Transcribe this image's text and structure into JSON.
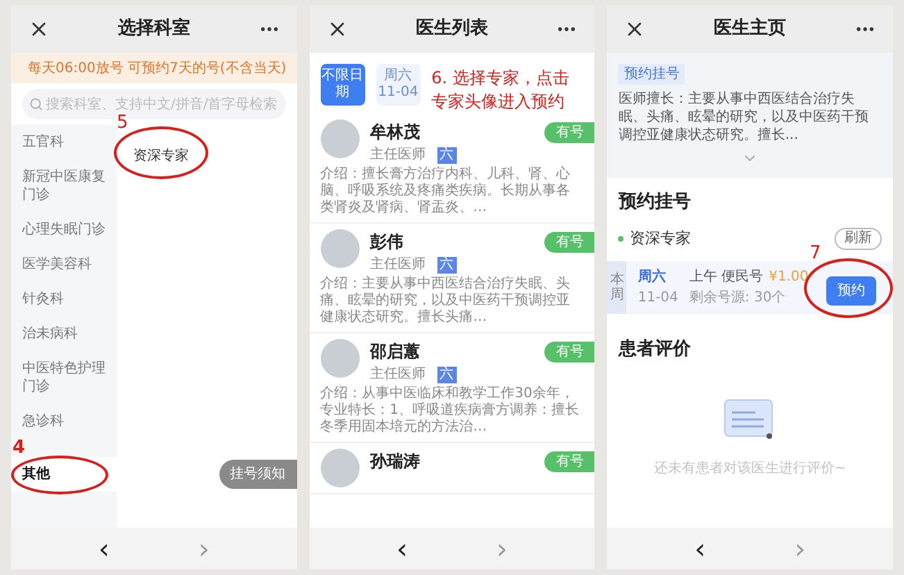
{
  "panels": [
    {
      "kind": "departments",
      "title": "选择科室",
      "notice": "每天06:00放号 可预约7天的号(不含当天)",
      "search": {
        "placeholder": "搜索科室、支持中文/拼音/首字母检索"
      },
      "departments": [
        {
          "label": "五官科",
          "selected": false
        },
        {
          "label": "新冠中医康复门诊",
          "selected": false
        },
        {
          "label": "心理失眠门诊",
          "selected": false
        },
        {
          "label": "医学美容科",
          "selected": false
        },
        {
          "label": "针灸科",
          "selected": false
        },
        {
          "label": "治未病科",
          "selected": false
        },
        {
          "label": "中医特色护理门诊",
          "selected": false
        },
        {
          "label": "急诊科",
          "selected": false
        },
        {
          "label": "其他",
          "selected": true,
          "annotation": "4"
        }
      ],
      "subdepartments": [
        {
          "label": "资深专家",
          "annotation": "5"
        }
      ],
      "floating_button": "挂号须知",
      "nav": {
        "back": {
          "label": "‹",
          "disabled": false
        },
        "forward": {
          "label": "›",
          "disabled": true
        }
      }
    },
    {
      "kind": "doctors",
      "title": "医生列表",
      "dates": [
        {
          "label": "不限日期",
          "selected": true
        },
        {
          "label": "周六",
          "date": "11-04",
          "selected": false
        }
      ],
      "annotation": "6. 选择专家，点击专家头像进入预约",
      "doctors": [
        {
          "name": "牟林茂",
          "title": "主任医师",
          "tag": "六",
          "badge": "有号",
          "intro": "介绍：擅长膏方治疗内科、儿科、肾、心脑、呼吸系统及疼痛类疾病。长期从事各类肾炎及肾病、肾盂炎、…"
        },
        {
          "name": "彭伟",
          "title": "主任医师",
          "tag": "六",
          "badge": "有号",
          "intro": "介绍：主要从事中西医结合治疗失眠、头痛、眩晕的研究，以及中医药干预调控亚健康状态研究。擅长头痛…"
        },
        {
          "name": "邵启蕙",
          "title": "主任医师",
          "tag": "六",
          "badge": "有号",
          "intro": "介绍：从事中医临床和教学工作30余年，专业特长：1、呼吸道疾病膏方调养：擅长冬季用固本培元的方法治…"
        },
        {
          "name": "孙瑞涛",
          "badge": "有号"
        }
      ],
      "nav": {
        "back": {
          "label": "‹",
          "disabled": false
        },
        "forward": {
          "label": "›",
          "disabled": true
        }
      }
    },
    {
      "kind": "doctor_home",
      "title": "医生主页",
      "profile": {
        "tag": "预约挂号",
        "specialty": "医师擅长：主要从事中西医结合治疗失眠、头痛、眩晕的研究，以及中医药干预调控亚健康状态研究。擅长..."
      },
      "booking": {
        "heading": "预约挂号",
        "group": "资深专家",
        "refresh": "刷新",
        "slots": [
          {
            "week": "本周",
            "day": "周六",
            "date": "11-04",
            "session": "上午 便民号",
            "price": "¥1.00",
            "remaining": "剩余号源: 30个",
            "button": "预约",
            "annotation": "7"
          }
        ]
      },
      "reviews": {
        "heading": "患者评价",
        "empty": "还未有患者对该医生进行评价~"
      },
      "nav": {
        "back": {
          "label": "‹",
          "disabled": false
        },
        "forward": {
          "label": "›",
          "disabled": true
        }
      }
    }
  ]
}
